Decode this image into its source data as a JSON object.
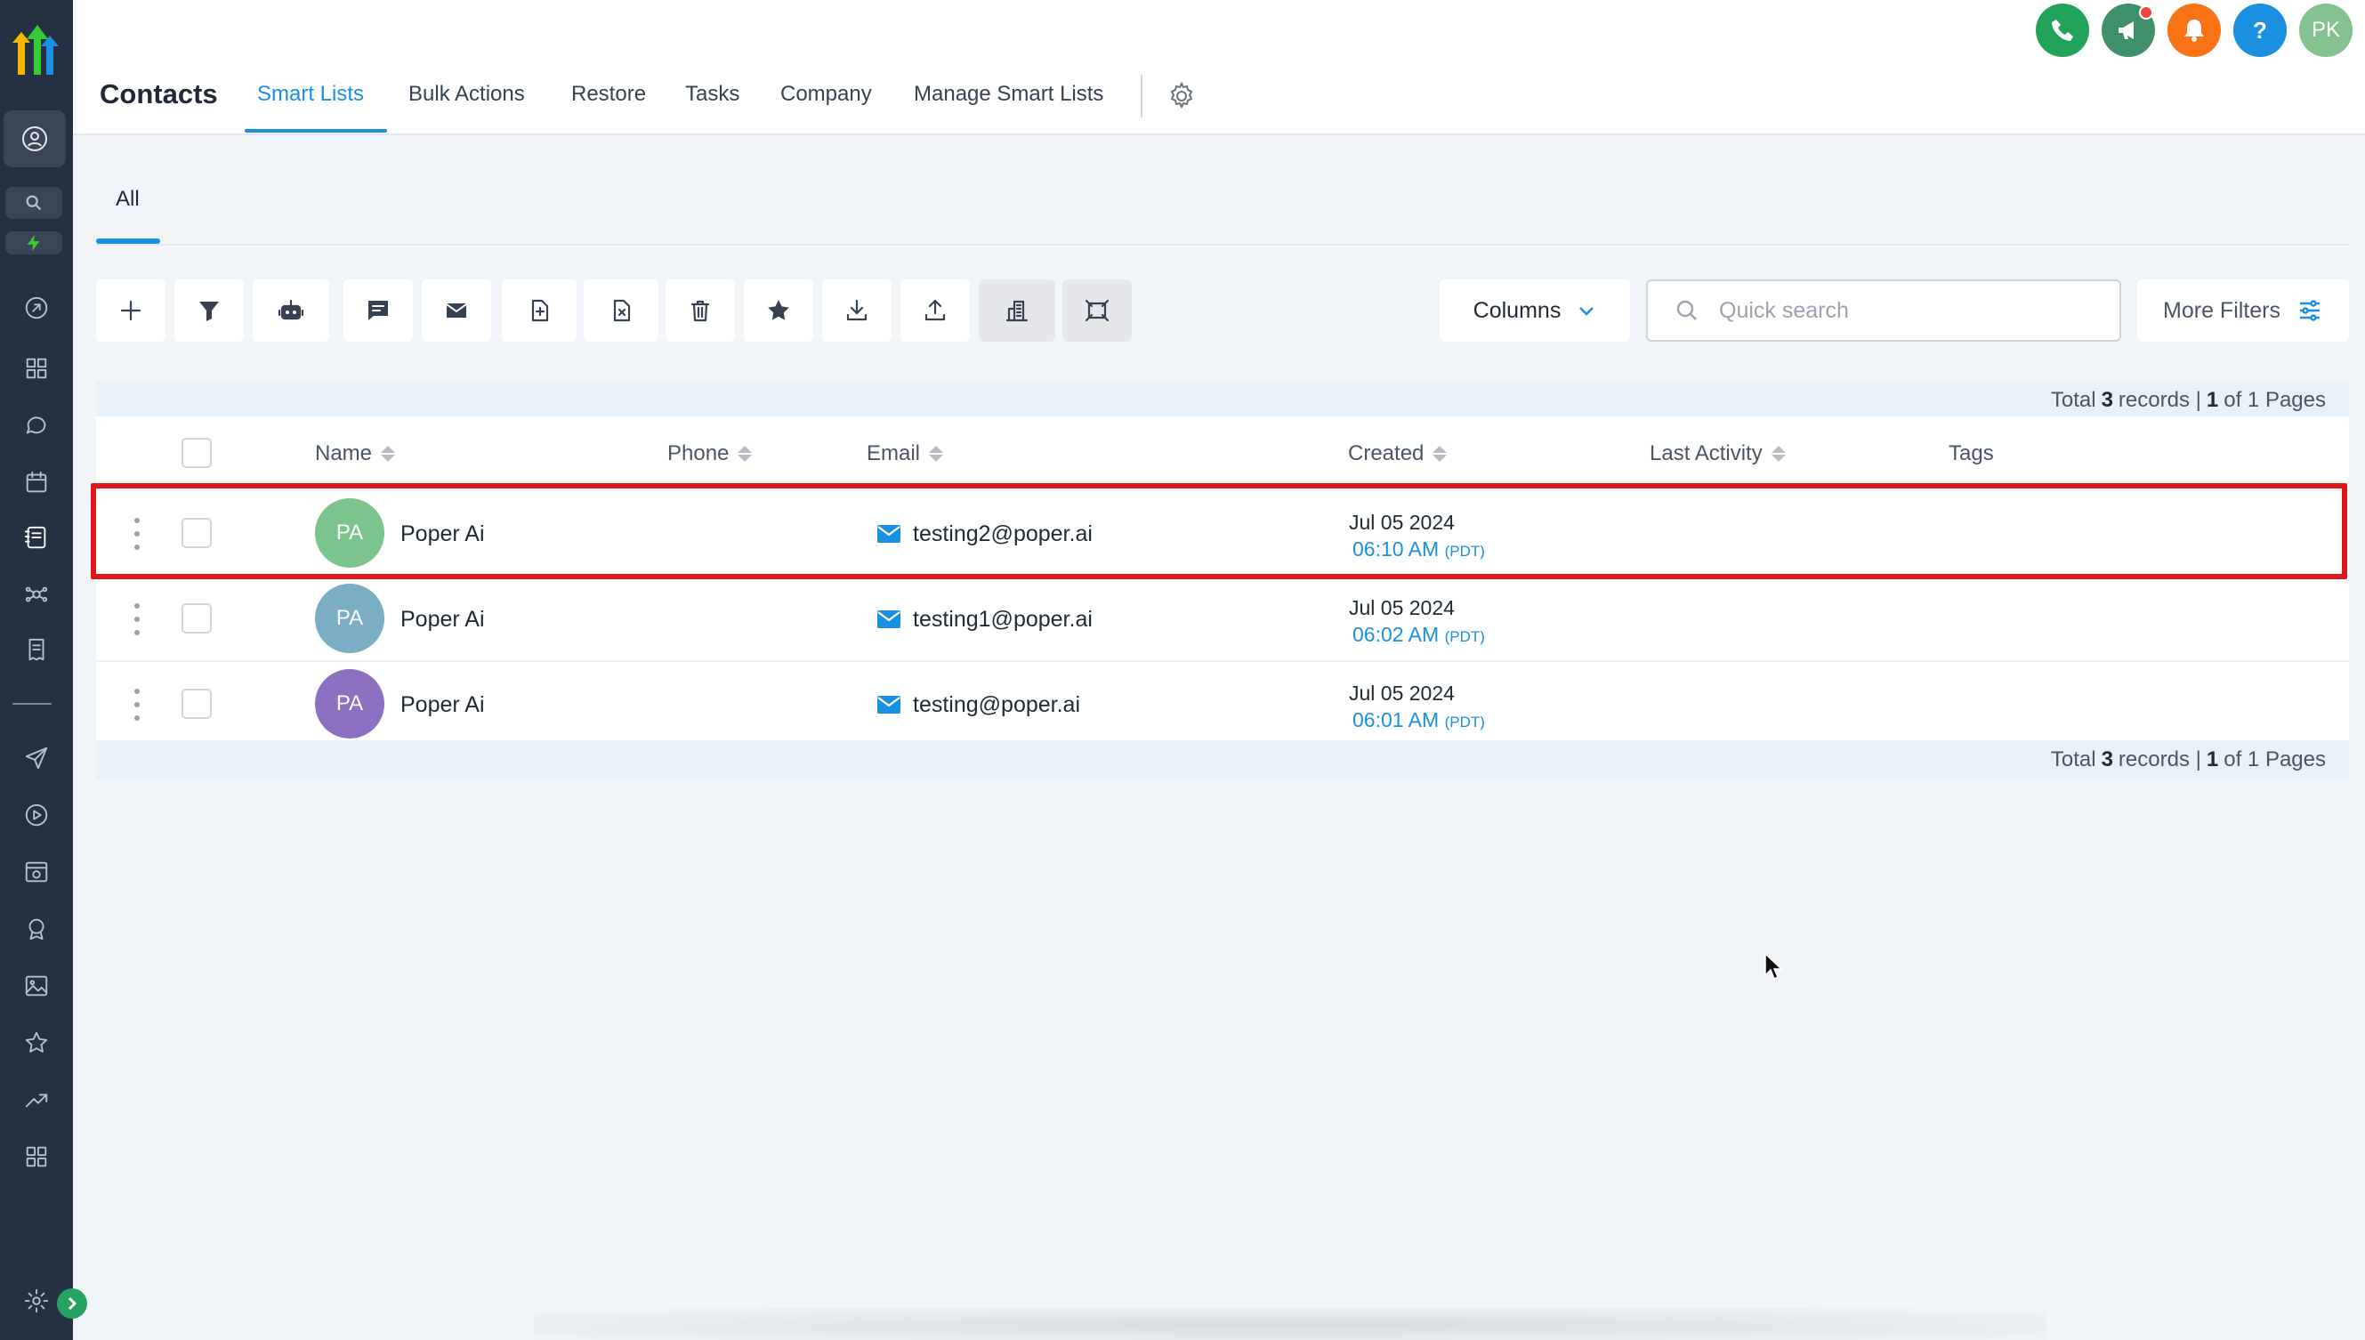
{
  "header": {
    "page_title": "Contacts",
    "nav": [
      {
        "label": "Smart Lists",
        "active": true
      },
      {
        "label": "Bulk Actions",
        "active": false
      },
      {
        "label": "Restore",
        "active": false
      },
      {
        "label": "Tasks",
        "active": false
      },
      {
        "label": "Company",
        "active": false
      },
      {
        "label": "Manage Smart Lists",
        "active": false
      }
    ],
    "user_initials": "PK",
    "icons": [
      "phone-icon",
      "megaphone-icon",
      "bell-icon",
      "help-icon"
    ]
  },
  "subtabs": [
    {
      "label": "All",
      "active": true
    }
  ],
  "toolbar": {
    "actions": [
      "add-icon",
      "filter-icon",
      "bot-icon",
      "sms-icon",
      "email-icon",
      "add-tag-icon",
      "remove-tag-icon",
      "delete-icon",
      "star-icon",
      "import-icon",
      "export-icon",
      "company-icon",
      "merge-icon"
    ],
    "columns_label": "Columns",
    "search_placeholder": "Quick search",
    "more_filters_label": "More Filters"
  },
  "records": {
    "prefix": "Total",
    "count": "3",
    "records_label": "records |",
    "page": "1",
    "of_label": "of",
    "total_pages": "1",
    "pages_label": "Pages"
  },
  "table": {
    "columns": [
      "Name",
      "Phone",
      "Email",
      "Created",
      "Last Activity",
      "Tags"
    ],
    "rows": [
      {
        "initials": "PA",
        "name": "Poper Ai",
        "phone": "",
        "email": "testing2@poper.ai",
        "date": "Jul 05 2024",
        "time": "06:10 AM",
        "tz": "(PDT)",
        "avatar_color": "#7cc48e"
      },
      {
        "initials": "PA",
        "name": "Poper Ai",
        "phone": "",
        "email": "testing1@poper.ai",
        "date": "Jul 05 2024",
        "time": "06:02 AM",
        "tz": "(PDT)",
        "avatar_color": "#7badc4"
      },
      {
        "initials": "PA",
        "name": "Poper Ai",
        "phone": "",
        "email": "testing@poper.ai",
        "date": "Jul 05 2024",
        "time": "06:01 AM",
        "tz": "(PDT)",
        "avatar_color": "#8d70c1"
      }
    ]
  },
  "colors": {
    "accent": "#1b8fe0",
    "sidebar": "#243142",
    "highlight": "#e1171e"
  }
}
